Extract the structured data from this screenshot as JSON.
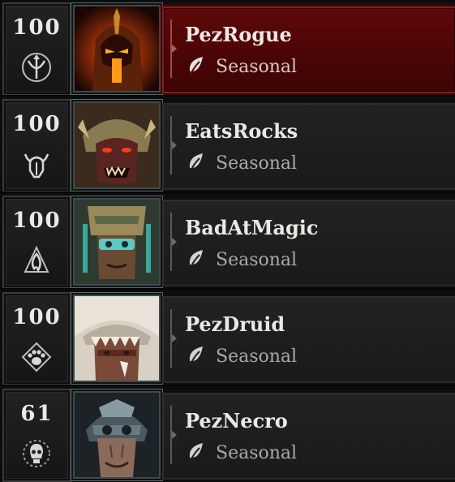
{
  "characters": [
    {
      "level": "100",
      "class_icon": "rogue-bow-icon",
      "name": "PezRogue",
      "mode": "Seasonal",
      "selected": true
    },
    {
      "level": "100",
      "class_icon": "barbarian-helm-icon",
      "name": "EatsRocks",
      "mode": "Seasonal",
      "selected": false
    },
    {
      "level": "100",
      "class_icon": "sorcerer-flame-icon",
      "name": "BadAtMagic",
      "mode": "Seasonal",
      "selected": false
    },
    {
      "level": "100",
      "class_icon": "druid-paw-icon",
      "name": "PezDruid",
      "mode": "Seasonal",
      "selected": false
    },
    {
      "level": "61",
      "class_icon": "necromancer-skull-icon",
      "name": "PezNecro",
      "mode": "Seasonal",
      "selected": false
    }
  ],
  "colors": {
    "selected_panel": "#5e0909",
    "panel": "#1f1f1f",
    "name_text": "#ece8e4",
    "mode_text": "#a9a9a9"
  }
}
